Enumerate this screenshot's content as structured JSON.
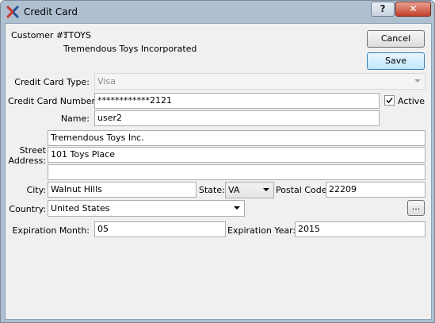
{
  "window": {
    "title": "Credit Card",
    "help_label": "?",
    "close_label": "✕"
  },
  "customer": {
    "label": "Customer #:",
    "number": "TTOYS",
    "name": "Tremendous Toys Incorporated"
  },
  "buttons": {
    "cancel": "Cancel",
    "save": "Save",
    "lookup": "..."
  },
  "form": {
    "card_type_label": "Credit Card Type:",
    "card_type_value": "Visa",
    "card_number_label": "Credit Card Number:",
    "card_number_value": "************2121",
    "active_label": "Active",
    "active_checked": true,
    "name_label": "Name:",
    "name_value": "user2",
    "street_label_1": "Street",
    "street_label_2": "Address:",
    "street_line1": "Tremendous Toys Inc.",
    "street_line2": "101 Toys Place",
    "street_line3": "",
    "city_label": "City:",
    "city_value": "Walnut Hills",
    "state_label": "State:",
    "state_value": "VA",
    "postal_label": "Postal Code:",
    "postal_value": "22209",
    "country_label": "Country:",
    "country_value": "United States",
    "exp_month_label": "Expiration Month:",
    "exp_month_value": "05",
    "exp_year_label": "Expiration Year:",
    "exp_year_value": "2015"
  },
  "colors": {
    "title_bar": "#aebfd0",
    "close_button": "#c0402a",
    "client_bg": "#f0f0f0"
  }
}
